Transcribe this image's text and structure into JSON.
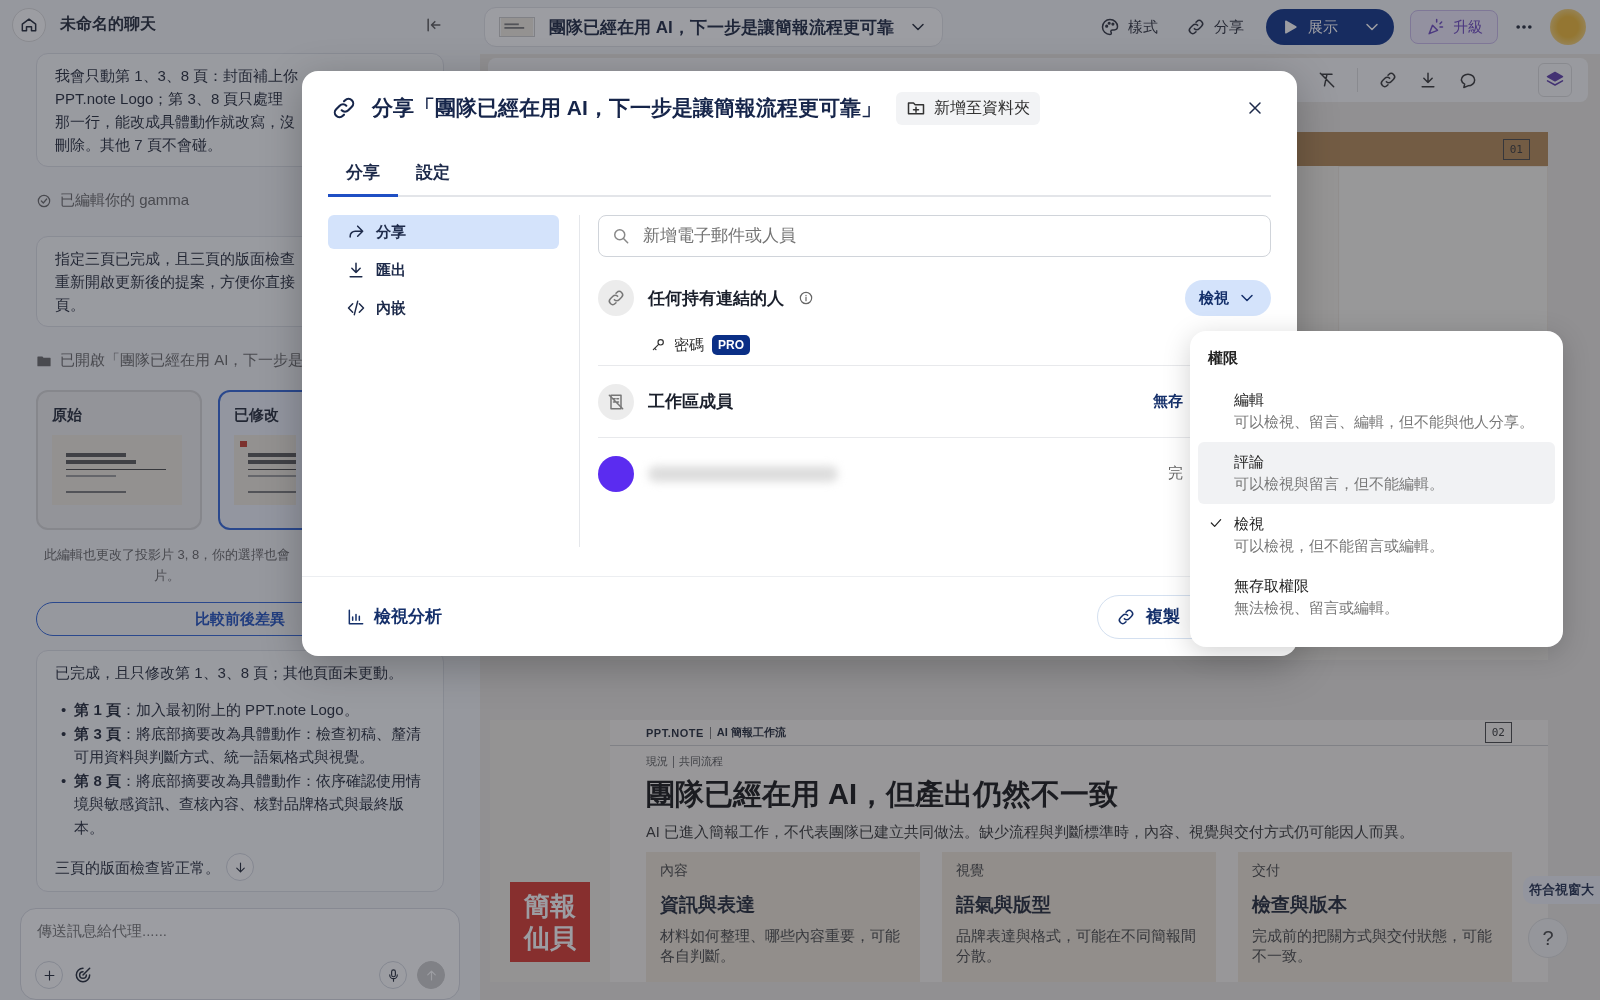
{
  "chat": {
    "title": "未命名的聊天",
    "bubble1": {
      "lines": [
        "我會只動第 1、3、8 頁：封面補上你",
        "PPT.note Logo；第 3、8 頁只處理",
        "那一行，能改成具體動作就改寫，沒",
        "刪除。其他 7 頁不會碰。"
      ]
    },
    "status": {
      "text": "已編輯你的 gamma"
    },
    "bubble2": {
      "lines": [
        "指定三頁已完成，且三頁的版面檢查",
        "重新開啟更新後的提案，方便你直接",
        "頁。"
      ]
    },
    "opened": {
      "text": "已開啟「團隊已經在用 AI，下一步是"
    },
    "versions": [
      {
        "label": "原始",
        "selected": false
      },
      {
        "label": "已修改",
        "selected": true
      }
    ],
    "note": {
      "lines": [
        "此編輯也更改了投影片 3, 8，你的選擇也會",
        "片。"
      ]
    },
    "compare_button": "比較前後差異",
    "answer": {
      "intro": "已完成，且只修改第 1、3、8 頁；其他頁面未更動。",
      "marker": "•",
      "bullets": [
        "**第 1 頁**：加入最初附上的 PPT.note Logo。",
        "**第 3 頁**：將底部摘要改為具體動作：檢查初稿、釐清可用資料與判斷方式、統一語氣格式與視覺。",
        "**第 8 頁**：將底部摘要改為具體動作：依序確認使用情境與敏感資訊、查核內容、核對品牌格式與最終版本。"
      ],
      "outro": "三頁的版面檢查皆正常。"
    },
    "composer": {
      "placeholder": "傳送訊息給代理......"
    }
  },
  "topbar": {
    "doc_title": "團隊已經在用 AI，下一步是讓簡報流程更可靠",
    "actions": [
      {
        "label": "樣式",
        "kind": "palette"
      },
      {
        "label": "分享",
        "kind": "link"
      }
    ],
    "present": "展示",
    "upgrade": "升級"
  },
  "slide1": {
    "number": "01"
  },
  "slide2": {
    "number": "02",
    "brand": "PPT.NOTE",
    "section": "AI 簡報工作流",
    "eyebrow": "現況",
    "eyebrow2": "共同流程",
    "heading": "團隊已經在用 AI，但產出仍然不一致",
    "subtitle": "AI 已進入簡報工作，不代表團隊已建立共同做法。缺少流程與判斷標準時，內容、視覺與交付方式仍可能因人而異。",
    "cards": [
      {
        "tag": "內容",
        "title": "資訊與表達",
        "text": "材料如何整理、哪些內容重要，可能各自判斷。"
      },
      {
        "tag": "視覺",
        "title": "語氣與版型",
        "text": "品牌表達與格式，可能在不同簡報間分散。"
      },
      {
        "tag": "交付",
        "title": "檢查與版本",
        "text": "完成前的把關方式與交付狀態，可能不一致。"
      }
    ]
  },
  "logo": {
    "text": "簡報仙貝"
  },
  "fit_button": "符合視窗大",
  "help_button": "?",
  "share_dialog": {
    "title": "分享「團隊已經在用 AI，下一步是讓簡報流程更可靠」",
    "add_folder": "新增至資料夾",
    "tabs": [
      {
        "label": "分享",
        "selected": true
      },
      {
        "label": "設定",
        "selected": false
      }
    ],
    "nav": [
      {
        "label": "分享",
        "kind": "share",
        "selected": true
      },
      {
        "label": "匯出",
        "kind": "export",
        "selected": false
      },
      {
        "label": "內嵌",
        "kind": "embed",
        "selected": false
      }
    ],
    "search": {
      "placeholder": "新增電子郵件或人員"
    },
    "link_access": {
      "label": "任何持有連結的人",
      "permission": "檢視"
    },
    "password": {
      "label": "密碼",
      "badge": "PRO"
    },
    "members": [
      {
        "kind": "workspace",
        "label": "工作區成員",
        "permission": "無存"
      },
      {
        "kind": "person",
        "permission": "完"
      }
    ],
    "analytics": "檢視分析",
    "copy_button": "複製"
  },
  "permission_menu": {
    "title": "權限",
    "options": [
      {
        "label": "編輯",
        "description": "可以檢視、留言、編輯，但不能與他人分享。",
        "checked": false,
        "highlighted": false
      },
      {
        "label": "評論",
        "description": "可以檢視與留言，但不能編輯。",
        "checked": false,
        "highlighted": true
      },
      {
        "label": "檢視",
        "description": "可以檢視，但不能留言或編輯。",
        "checked": true,
        "highlighted": false
      },
      {
        "label": "無存取權限",
        "description": "無法檢視、留言或編輯。",
        "checked": false,
        "highlighted": false
      }
    ]
  }
}
